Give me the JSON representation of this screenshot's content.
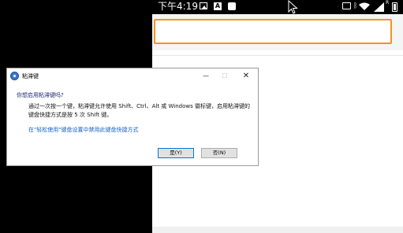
{
  "status_bar": {
    "time": "下午4:19",
    "notification_badge": "A"
  },
  "dialog": {
    "title": "粘滞键",
    "minimize": "—",
    "maximize": "☐",
    "close": "✕",
    "question": "你想启用粘滞键吗?",
    "description": "通过一次按一个键，粘滞键允许使用 Shift、Ctrl、Alt 或 Windows 徽标键，启用粘滞键的键盘快捷方式是按 5 次 Shift 键。",
    "link": "在\"轻松使用\"键盘设置中禁用此键盘快捷方式",
    "yes_button": "是(Y)",
    "no_button": "否(N)"
  },
  "colors": {
    "address_bar_border": "#f0961e",
    "link": "#1060c8",
    "question": "#1a2b6e",
    "default_button_border": "#0078d7"
  }
}
